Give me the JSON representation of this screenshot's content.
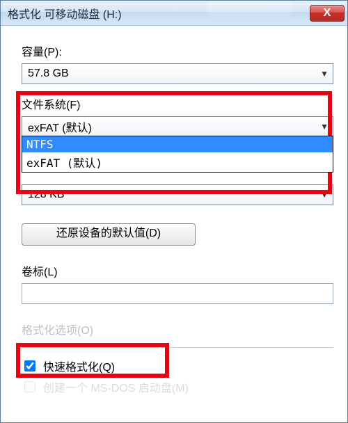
{
  "titlebar": {
    "title": "格式化 可移动磁盘 (H:)",
    "close_glyph": "X"
  },
  "capacity": {
    "label": "容量(P):",
    "value": "57.8 GB"
  },
  "filesystem": {
    "label": "文件系统(F)",
    "value": "exFAT (默认)",
    "options": [
      "NTFS",
      "exFAT (默认)"
    ],
    "selected_index": 0
  },
  "allocation": {
    "value": "128 KB"
  },
  "restore_defaults": {
    "label": "还原设备的默认值(D)"
  },
  "volume_label": {
    "label": "卷标(L)",
    "value": ""
  },
  "format_options": {
    "label": "格式化选项(O)",
    "quick_format": {
      "label": "快速格式化(Q)",
      "checked": true
    },
    "msdos_boot": {
      "label": "创建一个 MS-DOS 启动盘(M)",
      "checked": false,
      "disabled": true
    }
  },
  "dropdown_arrow": "▼"
}
